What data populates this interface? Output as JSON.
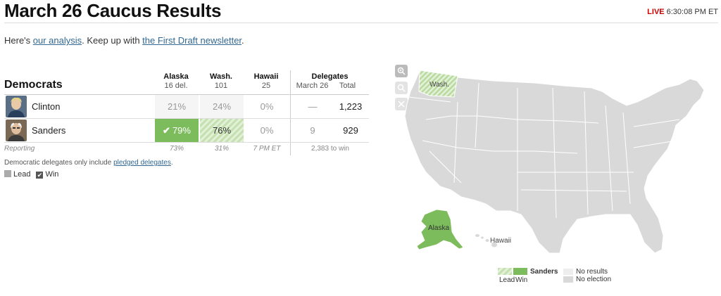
{
  "header": {
    "title": "March 26 Caucus Results",
    "live_label": "LIVE",
    "time": "6:30:08 PM ET"
  },
  "intro": {
    "prefix": "Here's ",
    "link1": "our analysis",
    "middle": ". Keep up with ",
    "link2": "the First Draft newsletter",
    "suffix": "."
  },
  "table": {
    "party": "Democrats",
    "columns": [
      {
        "name": "Alaska",
        "sub": "16 del."
      },
      {
        "name": "Wash.",
        "sub": "101"
      },
      {
        "name": "Hawaii",
        "sub": "25"
      }
    ],
    "delegates_header": "Delegates",
    "delegates_sub": [
      "March 26",
      "Total"
    ],
    "rows": [
      {
        "name": "Clinton",
        "values": [
          "21%",
          "24%",
          "0%"
        ],
        "march26": "—",
        "total": "1,223"
      },
      {
        "name": "Sanders",
        "values": [
          "79%",
          "76%",
          "0%"
        ],
        "march26": "9",
        "total": "929",
        "check": "✔"
      }
    ],
    "reporting_label": "Reporting",
    "reporting": [
      "73%",
      "31%",
      "7 PM ET"
    ],
    "to_win": "2,383 to win",
    "note_prefix": "Democratic delegates only include ",
    "note_link": "pledged delegates",
    "note_suffix": ".",
    "legend_lead": "Lead",
    "legend_win": "Win"
  },
  "map": {
    "label_wash": "Wash.",
    "label_alaska": "Alaska",
    "label_hawaii": "Hawaii",
    "controls": [
      "zoom-in-icon",
      "zoom-out-icon",
      "close-icon"
    ],
    "legend": {
      "candidate": "Sanders",
      "lead": "Lead",
      "win": "Win",
      "no_results": "No results",
      "no_election": "No election"
    }
  },
  "colors": {
    "win": "#7dbc5c",
    "lead": "#c6e1b1",
    "state": "#d9d9d9",
    "live": "#cc0000",
    "link": "#326891"
  }
}
